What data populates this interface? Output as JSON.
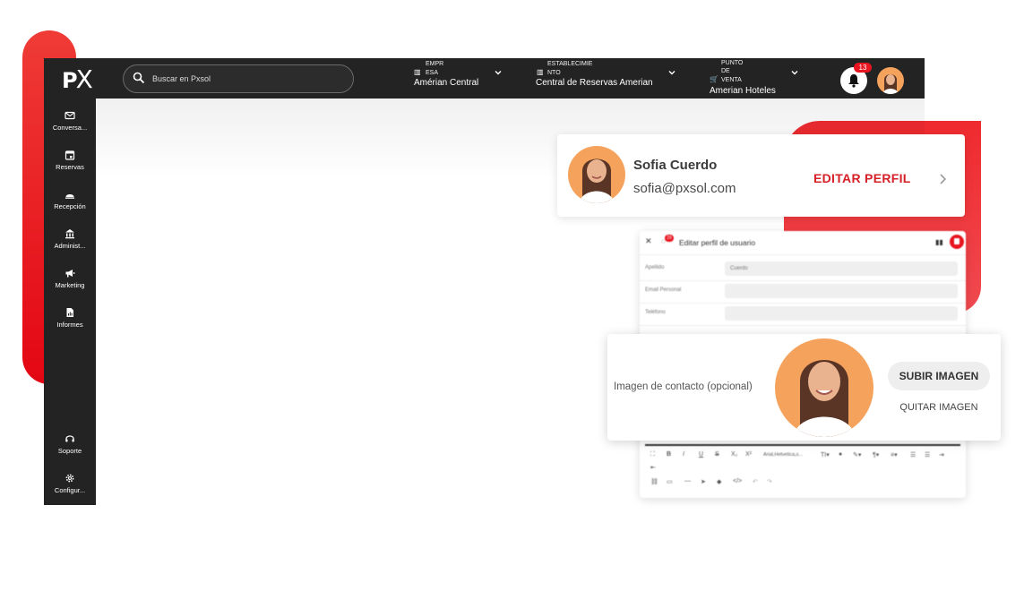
{
  "colors": {
    "accent": "#e8141f",
    "topbar": "#232323",
    "avatar_bg": "#f5a25d"
  },
  "topbar": {
    "logo": {
      "p": "P",
      "x": "X"
    },
    "search": {
      "placeholder": "Buscar en Pxsol",
      "icon": "search-icon"
    },
    "company": {
      "label_line1": "EMPR",
      "label_line2": "ESA",
      "value": "Amérian Central"
    },
    "establishment": {
      "label_line1": "ESTABLECIMIE",
      "label_line2": "NTO",
      "value": "Central de Reservas Amerian"
    },
    "pos": {
      "label_line1": "PUNTO",
      "label_line2": "DE",
      "label_line3": "VENTA",
      "value": "Amerian Hoteles"
    },
    "notifications": {
      "count": "13",
      "icon": "bell-icon"
    }
  },
  "sidebar": {
    "items": [
      {
        "label": "Conversa...",
        "icon": "mail-icon"
      },
      {
        "label": "Reservas",
        "icon": "calendar-icon"
      },
      {
        "label": "Recepción",
        "icon": "bell-desk-icon"
      },
      {
        "label": "Administ...",
        "icon": "bank-icon"
      },
      {
        "label": "Marketing",
        "icon": "megaphone-icon"
      },
      {
        "label": "Informes",
        "icon": "report-icon"
      }
    ],
    "bottom": [
      {
        "label": "Soporte",
        "icon": "support-icon"
      },
      {
        "label": "Configur...",
        "icon": "gear-icon"
      }
    ]
  },
  "profile_card": {
    "name": "Sofia Cuerdo",
    "email": "sofia@pxsol.com",
    "edit_label": "EDITAR PERFIL"
  },
  "edit_form": {
    "title": "Editar perfil de usuario",
    "badge": "29",
    "rows": [
      {
        "label": "Apellido",
        "value": "Cuerdo"
      },
      {
        "label": "Email Personal",
        "value": ""
      },
      {
        "label": "Teléfono",
        "value": ""
      }
    ],
    "toolbar_font": "Arial,Helvetica,s..."
  },
  "upload_card": {
    "label": "Imagen de contacto (opcional)",
    "upload_label": "SUBIR IMAGEN",
    "remove_label": "QUITAR IMAGEN"
  }
}
